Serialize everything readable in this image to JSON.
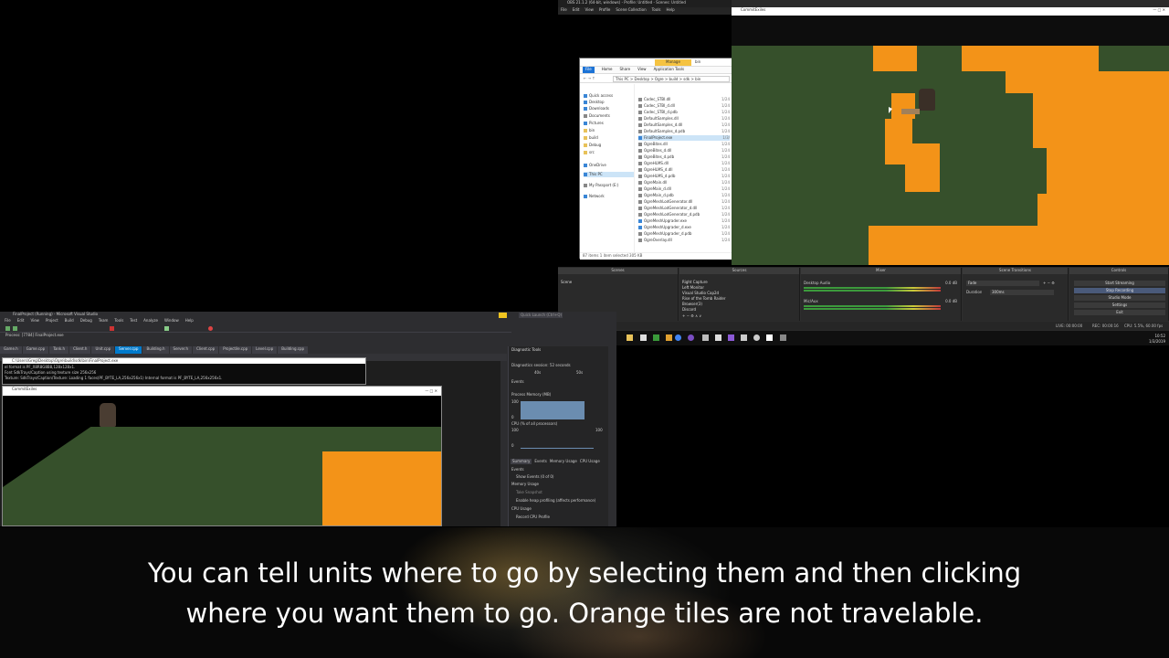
{
  "obs": {
    "title": "OBS 21.1.2 (64-bit, windows) - Profile: Untitled - Scenes: Untitled",
    "menu": [
      "File",
      "Edit",
      "View",
      "Profile",
      "Scene Collection",
      "Tools",
      "Help"
    ],
    "docks": {
      "scenes_header": "Scenes",
      "sources_header": "Sources",
      "mixer_header": "Mixer",
      "transitions_header": "Scene Transitions",
      "controls_header": "Controls",
      "scene_item": "Scene",
      "sources": [
        "Right Capture",
        "Left Monitor",
        "Visual Studio Cap2d",
        "Rise of the Tomb Raider",
        "Browser(3)",
        "Discord"
      ],
      "mixer_tracks": [
        "Desktop Audio",
        "Mic/Aux"
      ],
      "mixer_values": [
        "0.0 dB",
        "0.0 dB"
      ],
      "transition": "Fade",
      "duration_label": "Duration",
      "duration_value": "300ms",
      "controls": [
        "Start Streaming",
        "Stop Recording",
        "Studio Mode",
        "Settings",
        "Exit"
      ]
    },
    "status": {
      "live": "LIVE: 00:00:00",
      "rec": "REC: 00:00:16",
      "cpu": "CPU: 5.5%, 60.00 fps"
    },
    "clock": {
      "time": "10:52",
      "date": "1/3/2019"
    }
  },
  "explorer": {
    "manage_tab": "Manage",
    "bin_tab": "bin",
    "ribbon": [
      "File",
      "Home",
      "Share",
      "View",
      "Application Tools"
    ],
    "address": "This PC  >  Desktop  >  Ogre  >  build  >  sdk  >  bin",
    "nav": [
      "Quick access",
      "Desktop",
      "Downloads",
      "Documents",
      "Pictures",
      "bin",
      "build",
      "Debug",
      "src",
      "OneDrive",
      "This PC",
      "My Passport (E:)",
      "Network"
    ],
    "files": [
      {
        "name": "Codec_STBI.dll",
        "date": "1/24"
      },
      {
        "name": "Codec_STBI_d.dll",
        "date": "1/24"
      },
      {
        "name": "Codec_STBI_d.pdb",
        "date": "1/24"
      },
      {
        "name": "DefaultSamples.dll",
        "date": "1/24"
      },
      {
        "name": "DefaultSamples_d.dll",
        "date": "1/24"
      },
      {
        "name": "DefaultSamples_d.pdb",
        "date": "1/24"
      },
      {
        "name": "FinalProject.exe",
        "date": "1/3/"
      },
      {
        "name": "OgreBites.dll",
        "date": "1/24"
      },
      {
        "name": "OgreBites_d.dll",
        "date": "1/24"
      },
      {
        "name": "OgreBites_d.pdb",
        "date": "1/24"
      },
      {
        "name": "OgreHLMS.dll",
        "date": "1/24"
      },
      {
        "name": "OgreHLMS_d.dll",
        "date": "1/24"
      },
      {
        "name": "OgreHLMS_d.pdb",
        "date": "1/24"
      },
      {
        "name": "OgreMain.dll",
        "date": "1/24"
      },
      {
        "name": "OgreMain_d.dll",
        "date": "1/24"
      },
      {
        "name": "OgreMain_d.pdb",
        "date": "1/24"
      },
      {
        "name": "OgreMeshLodGenerator.dll",
        "date": "1/24"
      },
      {
        "name": "OgreMeshLodGenerator_d.dll",
        "date": "1/24"
      },
      {
        "name": "OgreMeshLodGenerator_d.pdb",
        "date": "1/24"
      },
      {
        "name": "OgreMeshUpgrader.exe",
        "date": "1/24"
      },
      {
        "name": "OgreMeshUpgrader_d.exe",
        "date": "1/24"
      },
      {
        "name": "OgreMeshUpgrader_d.pdb",
        "date": "1/24"
      },
      {
        "name": "OgreOverlay.dll",
        "date": "1/24"
      }
    ],
    "status": "87 items     1 item selected  305 KB"
  },
  "game_window": {
    "title": "CommitExiles"
  },
  "vs": {
    "title": "FinalProject (Running) - Microsoft Visual Studio",
    "menu": [
      "File",
      "Edit",
      "View",
      "Project",
      "Build",
      "Debug",
      "Team",
      "Tools",
      "Test",
      "Analyze",
      "Window",
      "Help"
    ],
    "quick_launch": "Quick Launch (Ctrl+Q)",
    "process_label": "Process: [7784] FinalProject.exe",
    "tabs": [
      "Game.h",
      "Game.cpp",
      "Tank.h",
      "Client.h",
      "Unit.cpp",
      "Server.cpp",
      "Building.h",
      "Server.h",
      "Client.cpp",
      "Projectile.cpp",
      "Level.cpp",
      "Building.cpp"
    ],
    "active_tab": "Server.cpp",
    "diag": {
      "title": "Diagnostic Tools",
      "session": "Diagnostics session: 52 seconds",
      "tick_left": "40s",
      "tick_right": "50s",
      "events": "Events",
      "memory": "Process Memory (MB)",
      "mem_max": "100",
      "mem_min": "0",
      "cpu": "CPU (% of all processors)",
      "cpu_max": "100",
      "cpu_min": "0",
      "tabs": [
        "Summary",
        "Events",
        "Memory Usage",
        "CPU Usage"
      ],
      "events2": "Events",
      "show_events": "Show Events (0 of 0)",
      "memory_usage": "Memory Usage",
      "take_snapshot": "Take Snapshot",
      "heap_profiling": "Enable heap profiling (affects performance)",
      "cpu_usage": "CPU Usage",
      "record_cpu": "Record CPU Profile"
    }
  },
  "console": {
    "title": "C:\\Users\\Greg\\Desktop\\Ogre\\build\\sdk\\bin\\FinalProject.exe",
    "lines": [
      "el format is PF_X8R8G8B8,128x128x1.",
      "Font SdkTrays/Caption using texture size 256x256",
      "Texture: SdkTrays/Caption/Texture: Loading 1 faces(PF_BYTE_LA,256x256x1) Internal format is PF_BYTE_LA,256x256x1."
    ]
  },
  "subtitle": {
    "line1": "You can tell units where to go by selecting them and then clicking",
    "line2": "where you want them to go. Orange tiles are not travelable."
  }
}
